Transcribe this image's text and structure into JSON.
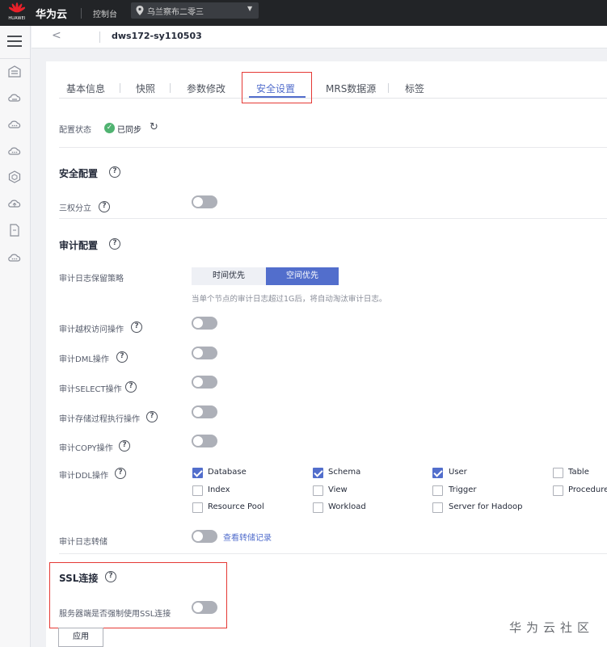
{
  "topbar": {
    "logo_text": "HUAWEI",
    "brand": "华为云",
    "console": "控制台",
    "region": "乌兰察布二零三"
  },
  "header": {
    "title": "dws172-sy110503"
  },
  "tabs": [
    {
      "label": "基本信息"
    },
    {
      "label": "快照"
    },
    {
      "label": "参数修改"
    },
    {
      "label": "安全设置"
    },
    {
      "label": "MRS数据源"
    },
    {
      "label": "标签"
    }
  ],
  "active_tab": "安全设置",
  "config_status": {
    "label": "配置状态",
    "value": "已同步"
  },
  "security": {
    "title": "安全配置",
    "separation_label": "三权分立",
    "separation_enabled": false
  },
  "audit": {
    "title": "审计配置",
    "retention_label": "审计日志保留策略",
    "retention_options": [
      "时间优先",
      "空间优先"
    ],
    "retention_selected": "空间优先",
    "retention_hint": "当单个节点的审计日志超过1G后，将自动淘汰审计日志。",
    "ops": [
      {
        "label": "审计越权访问操作",
        "enabled": false
      },
      {
        "label": "审计DML操作",
        "enabled": false
      },
      {
        "label": "审计SELECT操作",
        "enabled": false
      },
      {
        "label": "审计存储过程执行操作",
        "enabled": false
      },
      {
        "label": "审计COPY操作",
        "enabled": false
      }
    ],
    "ddl_label": "审计DDL操作",
    "ddl_options": [
      {
        "label": "Database",
        "checked": true
      },
      {
        "label": "Schema",
        "checked": true
      },
      {
        "label": "User",
        "checked": true
      },
      {
        "label": "Table",
        "checked": false
      },
      {
        "label": "Index",
        "checked": false
      },
      {
        "label": "View",
        "checked": false
      },
      {
        "label": "Trigger",
        "checked": false
      },
      {
        "label": "Procedure",
        "checked": false
      },
      {
        "label": "Resource Pool",
        "checked": false
      },
      {
        "label": "Workload",
        "checked": false
      },
      {
        "label": "Server for Hadoop",
        "checked": false
      }
    ],
    "dump_label": "审计日志转储",
    "dump_enabled": false,
    "dump_link": "查看转储记录"
  },
  "ssl": {
    "title": "SSL连接",
    "force_label": "服务器端是否强制使用SSL连接",
    "force_enabled": false
  },
  "apply_label": "应用",
  "watermark": "华为云社区",
  "icons": {
    "help": "?",
    "check": "✓",
    "refresh": "↻",
    "back": "<",
    "caret": "▼"
  },
  "colors": {
    "accent": "#526ecc",
    "topbar": "#222427",
    "highlight": "#e53935",
    "success": "#50b371"
  }
}
